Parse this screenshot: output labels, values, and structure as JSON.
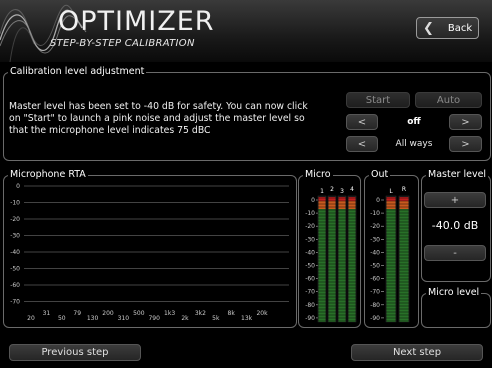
{
  "header": {
    "logo_title": "OPTIMIZER",
    "logo_subtitle": "STEP-BY-STEP CALIBRATION",
    "back_label": "Back"
  },
  "calibration": {
    "legend": "Calibration level adjustment",
    "instructions": "Master level has been set to -40 dB for safety. You can now click on \"Start\" to launch a pink noise and adjust the master level so that the microphone level indicates 75 dBC",
    "start_label": "Start",
    "auto_label": "Auto",
    "prev_label": "<",
    "next_label": ">",
    "level_value": "off",
    "mode_value": "All ways"
  },
  "rta": {
    "legend": "Microphone RTA",
    "y_ticks": [
      "0",
      "-10",
      "-20",
      "-30",
      "-40",
      "-50",
      "-60",
      "-70"
    ],
    "x_ticks_low": [
      "20",
      "50",
      "130",
      "310",
      "790",
      "2k",
      "5k",
      "13k"
    ],
    "x_ticks_high": [
      "31",
      "79",
      "200",
      "500",
      "1k3",
      "3k2",
      "8k",
      "20k"
    ]
  },
  "micro_meter": {
    "legend": "Micro",
    "channels": [
      "1",
      "2",
      "3",
      "4"
    ],
    "scale": [
      "0",
      "-10",
      "-20",
      "-30",
      "-40",
      "-50",
      "-60",
      "-70",
      "-80",
      "-90"
    ]
  },
  "out_meter": {
    "legend": "Out",
    "channels": [
      "L",
      "R"
    ],
    "scale": [
      "0",
      "-10",
      "-20",
      "-30",
      "-40",
      "-50",
      "-60",
      "-70",
      "-80",
      "-90"
    ]
  },
  "master": {
    "legend": "Master level",
    "plus_label": "+",
    "minus_label": "-",
    "value": "-40.0 dB"
  },
  "micro_level": {
    "legend": "Micro level"
  },
  "footer": {
    "previous_label": "Previous step",
    "next_label": "Next step"
  },
  "colors": {
    "background": "#000000",
    "panel_border": "#6a6a6a",
    "meter_green": "#2e8a2e",
    "meter_orange": "#c85a1e",
    "meter_red": "#c01e1e"
  }
}
